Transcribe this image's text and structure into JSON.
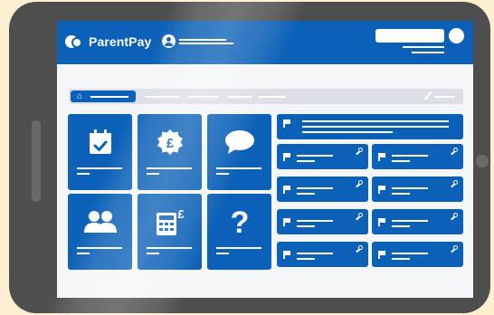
{
  "app": {
    "brand_name": "ParentPay"
  },
  "breadcrumb": {
    "home_icon": "home-icon"
  },
  "tiles": [
    {
      "name": "calendar-icon"
    },
    {
      "name": "pound-badge-icon",
      "glyph": "£"
    },
    {
      "name": "chat-bubble-icon"
    },
    {
      "name": "people-icon"
    },
    {
      "name": "calculator-icon",
      "glyph": "£"
    },
    {
      "name": "help-icon",
      "glyph": "?"
    }
  ],
  "panels": {
    "top_icon": "flag-icon",
    "item_icons": [
      "flag-icon",
      "key-icon"
    ],
    "count": 8
  },
  "colors": {
    "brand_blue": "#0b60b7",
    "tablet_frame": "#4e4e4e",
    "background": "#fdf0d0",
    "screen": "#f4f6fa",
    "breadcrumb_bar": "#dce0e6"
  }
}
